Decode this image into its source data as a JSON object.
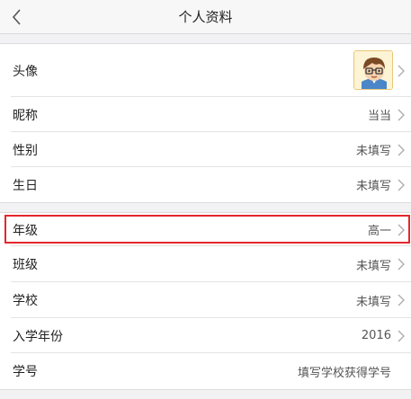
{
  "header": {
    "title": "个人资料"
  },
  "rows": {
    "avatar": {
      "label": "头像"
    },
    "nickname": {
      "label": "昵称",
      "value": "当当"
    },
    "gender": {
      "label": "性别",
      "value": "未填写"
    },
    "birthday": {
      "label": "生日",
      "value": "未填写"
    },
    "grade": {
      "label": "年级",
      "value": "高一"
    },
    "class": {
      "label": "班级",
      "value": "未填写"
    },
    "school": {
      "label": "学校",
      "value": "未填写"
    },
    "enroll_year": {
      "label": "入学年份",
      "value": "2016"
    },
    "student_id": {
      "label": "学号",
      "value": "填写学校获得学号"
    }
  },
  "icons": {
    "back": "chevron-left-icon",
    "row_arrow": "chevron-right-icon",
    "avatar": "cartoon-boy-avatar"
  },
  "colors": {
    "highlight": "#e3262c",
    "background": "#f2f2f4",
    "row_background": "#ffffff"
  }
}
